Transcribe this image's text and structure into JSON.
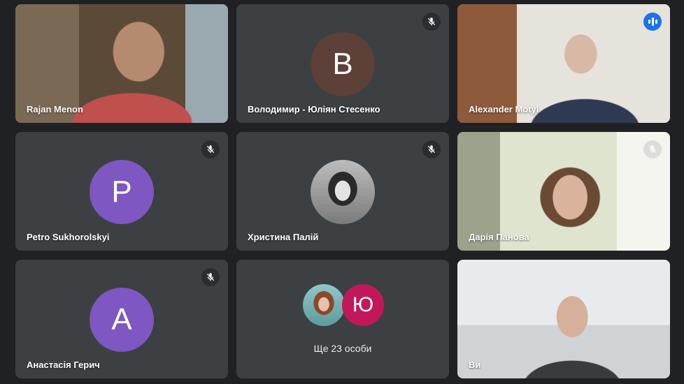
{
  "colors": {
    "background": "#202124",
    "tile": "#3c4043",
    "speaking_outline": "#8ab4f8",
    "speaking_badge": "#1a73e8",
    "avatar_b": "#5d4037",
    "avatar_p": "#7e57c2",
    "avatar_a": "#7e57c2",
    "avatar_yu": "#c2185b"
  },
  "tiles": [
    {
      "name": "Rajan Menon",
      "kind": "video",
      "muted": false
    },
    {
      "name": "Володимир - Юліян Стесенко",
      "kind": "avatar",
      "initial": "B",
      "muted": true,
      "icon": "mic-off-icon"
    },
    {
      "name": "Alexander Motyl",
      "kind": "video",
      "speaking": true,
      "icon": "speaking-indicator-icon"
    },
    {
      "name": "Petro Sukhorolskyi",
      "kind": "avatar",
      "initial": "P",
      "muted": true,
      "icon": "mic-off-icon"
    },
    {
      "name": "Христина Палій",
      "kind": "photo-avatar",
      "muted": true,
      "icon": "mic-off-icon"
    },
    {
      "name": "Дарія Панова",
      "kind": "video",
      "muted": true,
      "icon": "mic-off-icon"
    },
    {
      "name": "Анастасія Герич",
      "kind": "avatar",
      "initial": "A",
      "muted": true,
      "icon": "mic-off-icon"
    },
    {
      "name": "",
      "kind": "group",
      "initial": "Ю",
      "label": "Ще 23 особи"
    },
    {
      "name": "Ви",
      "kind": "video",
      "muted": false
    }
  ]
}
